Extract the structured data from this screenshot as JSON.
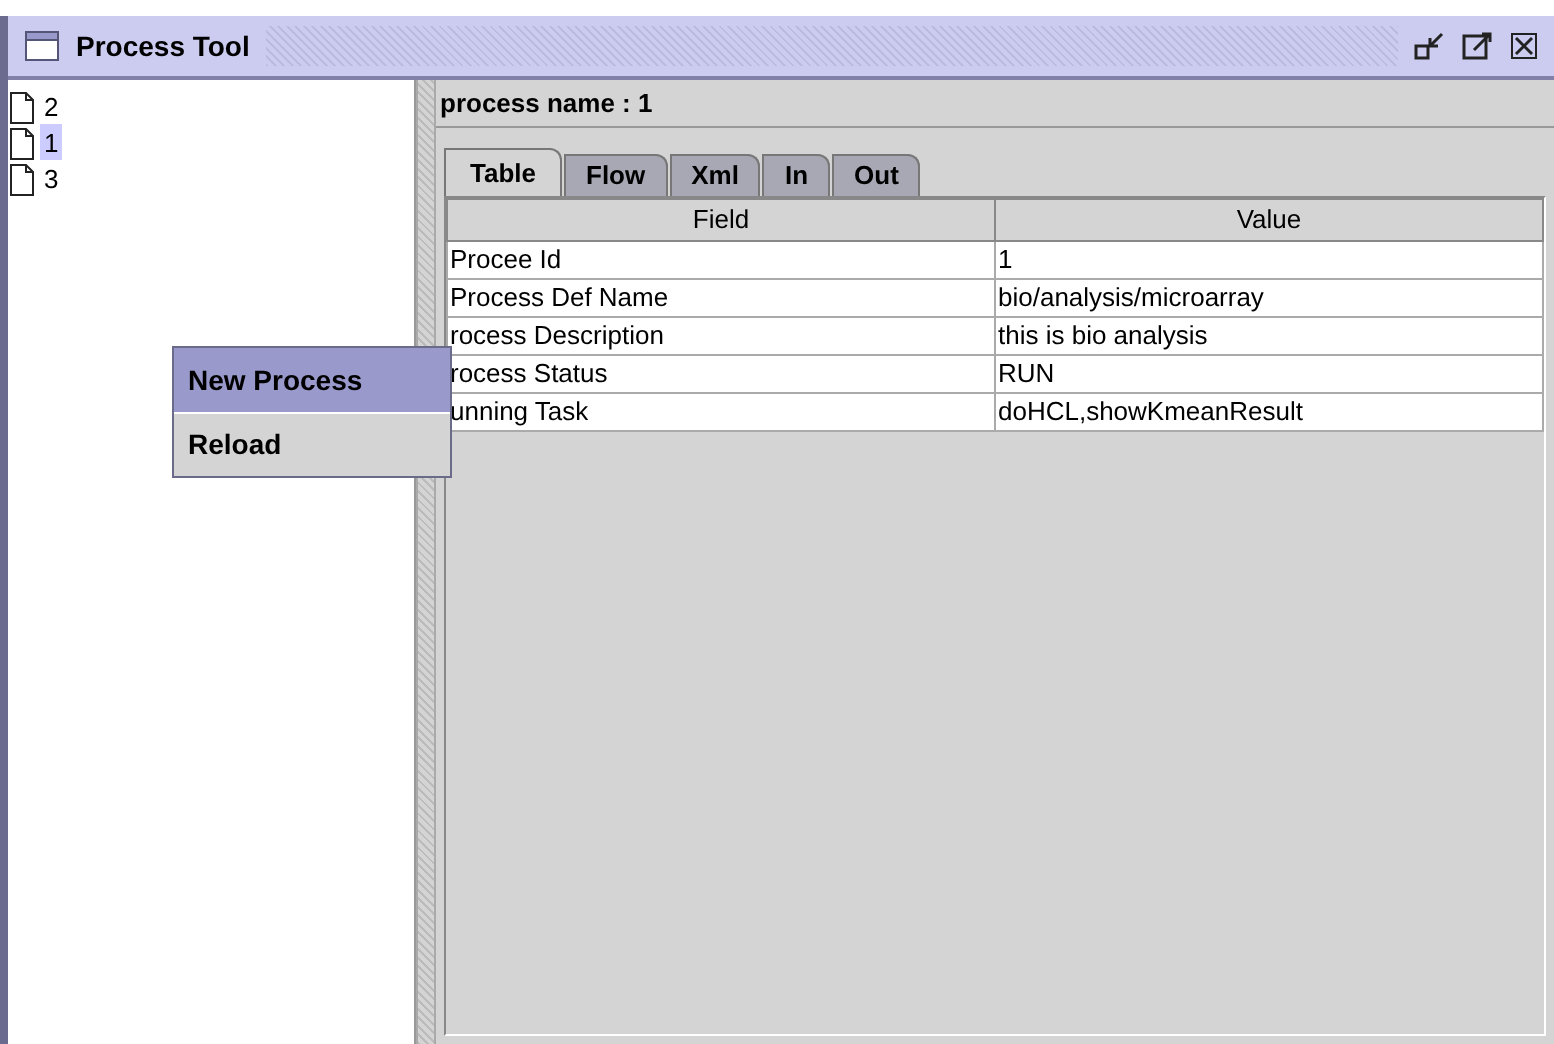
{
  "window": {
    "title": "Process Tool"
  },
  "tree": [
    {
      "label": "2",
      "selected": false
    },
    {
      "label": "1",
      "selected": true
    },
    {
      "label": "3",
      "selected": false
    }
  ],
  "context_menu": [
    {
      "label": "New Process",
      "selected": true
    },
    {
      "label": "Reload",
      "selected": false
    }
  ],
  "process_name": "process name : 1",
  "tabs": [
    {
      "label": "Table",
      "selected": true
    },
    {
      "label": "Flow",
      "selected": false
    },
    {
      "label": "Xml",
      "selected": false
    },
    {
      "label": "In",
      "selected": false
    },
    {
      "label": "Out",
      "selected": false
    }
  ],
  "table": {
    "columns": [
      "Field",
      "Value"
    ],
    "rows": [
      [
        "Procee Id",
        "1"
      ],
      [
        "Process Def Name",
        "bio/analysis/microarray"
      ],
      [
        "rocess Description",
        "this is bio analysis"
      ],
      [
        "rocess Status",
        "RUN"
      ],
      [
        "unning Task",
        "doHCL,showKmeanResult"
      ]
    ]
  }
}
